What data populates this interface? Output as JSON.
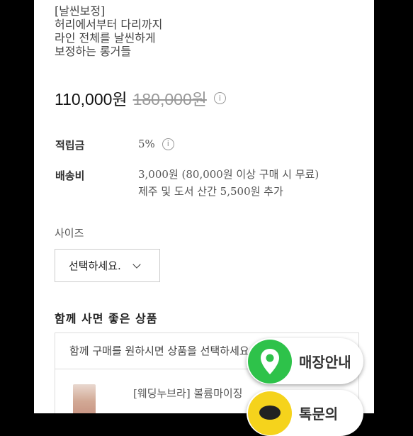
{
  "description": {
    "lines": [
      "[날씬보정]",
      "허리에서부터 다리까지",
      "라인 전체를 날씬하게",
      "보정하는 롱거들"
    ]
  },
  "price": {
    "sale": "110,000원",
    "original": "180,000원",
    "info_glyph": "i"
  },
  "points": {
    "label": "적립금",
    "value": "5%",
    "info_glyph": "i"
  },
  "shipping": {
    "label": "배송비",
    "line1": "3,000원 (80,000원 이상 구매 시 무료)",
    "line2": "제주 및 도서 산간 5,500원 추가"
  },
  "size": {
    "label": "사이즈",
    "selected": "선택하세요."
  },
  "together": {
    "title": "함께 사면 좋은 상품",
    "hint": "함께 구매를 원하시면 상품을 선택하세요",
    "product_name": "[웨딩누브라] 볼륨마이징"
  },
  "floating": {
    "store_label": "매장안내",
    "talk_label": "톡문의",
    "store_color": "#2ec24a",
    "talk_color": "#f5d31c"
  }
}
